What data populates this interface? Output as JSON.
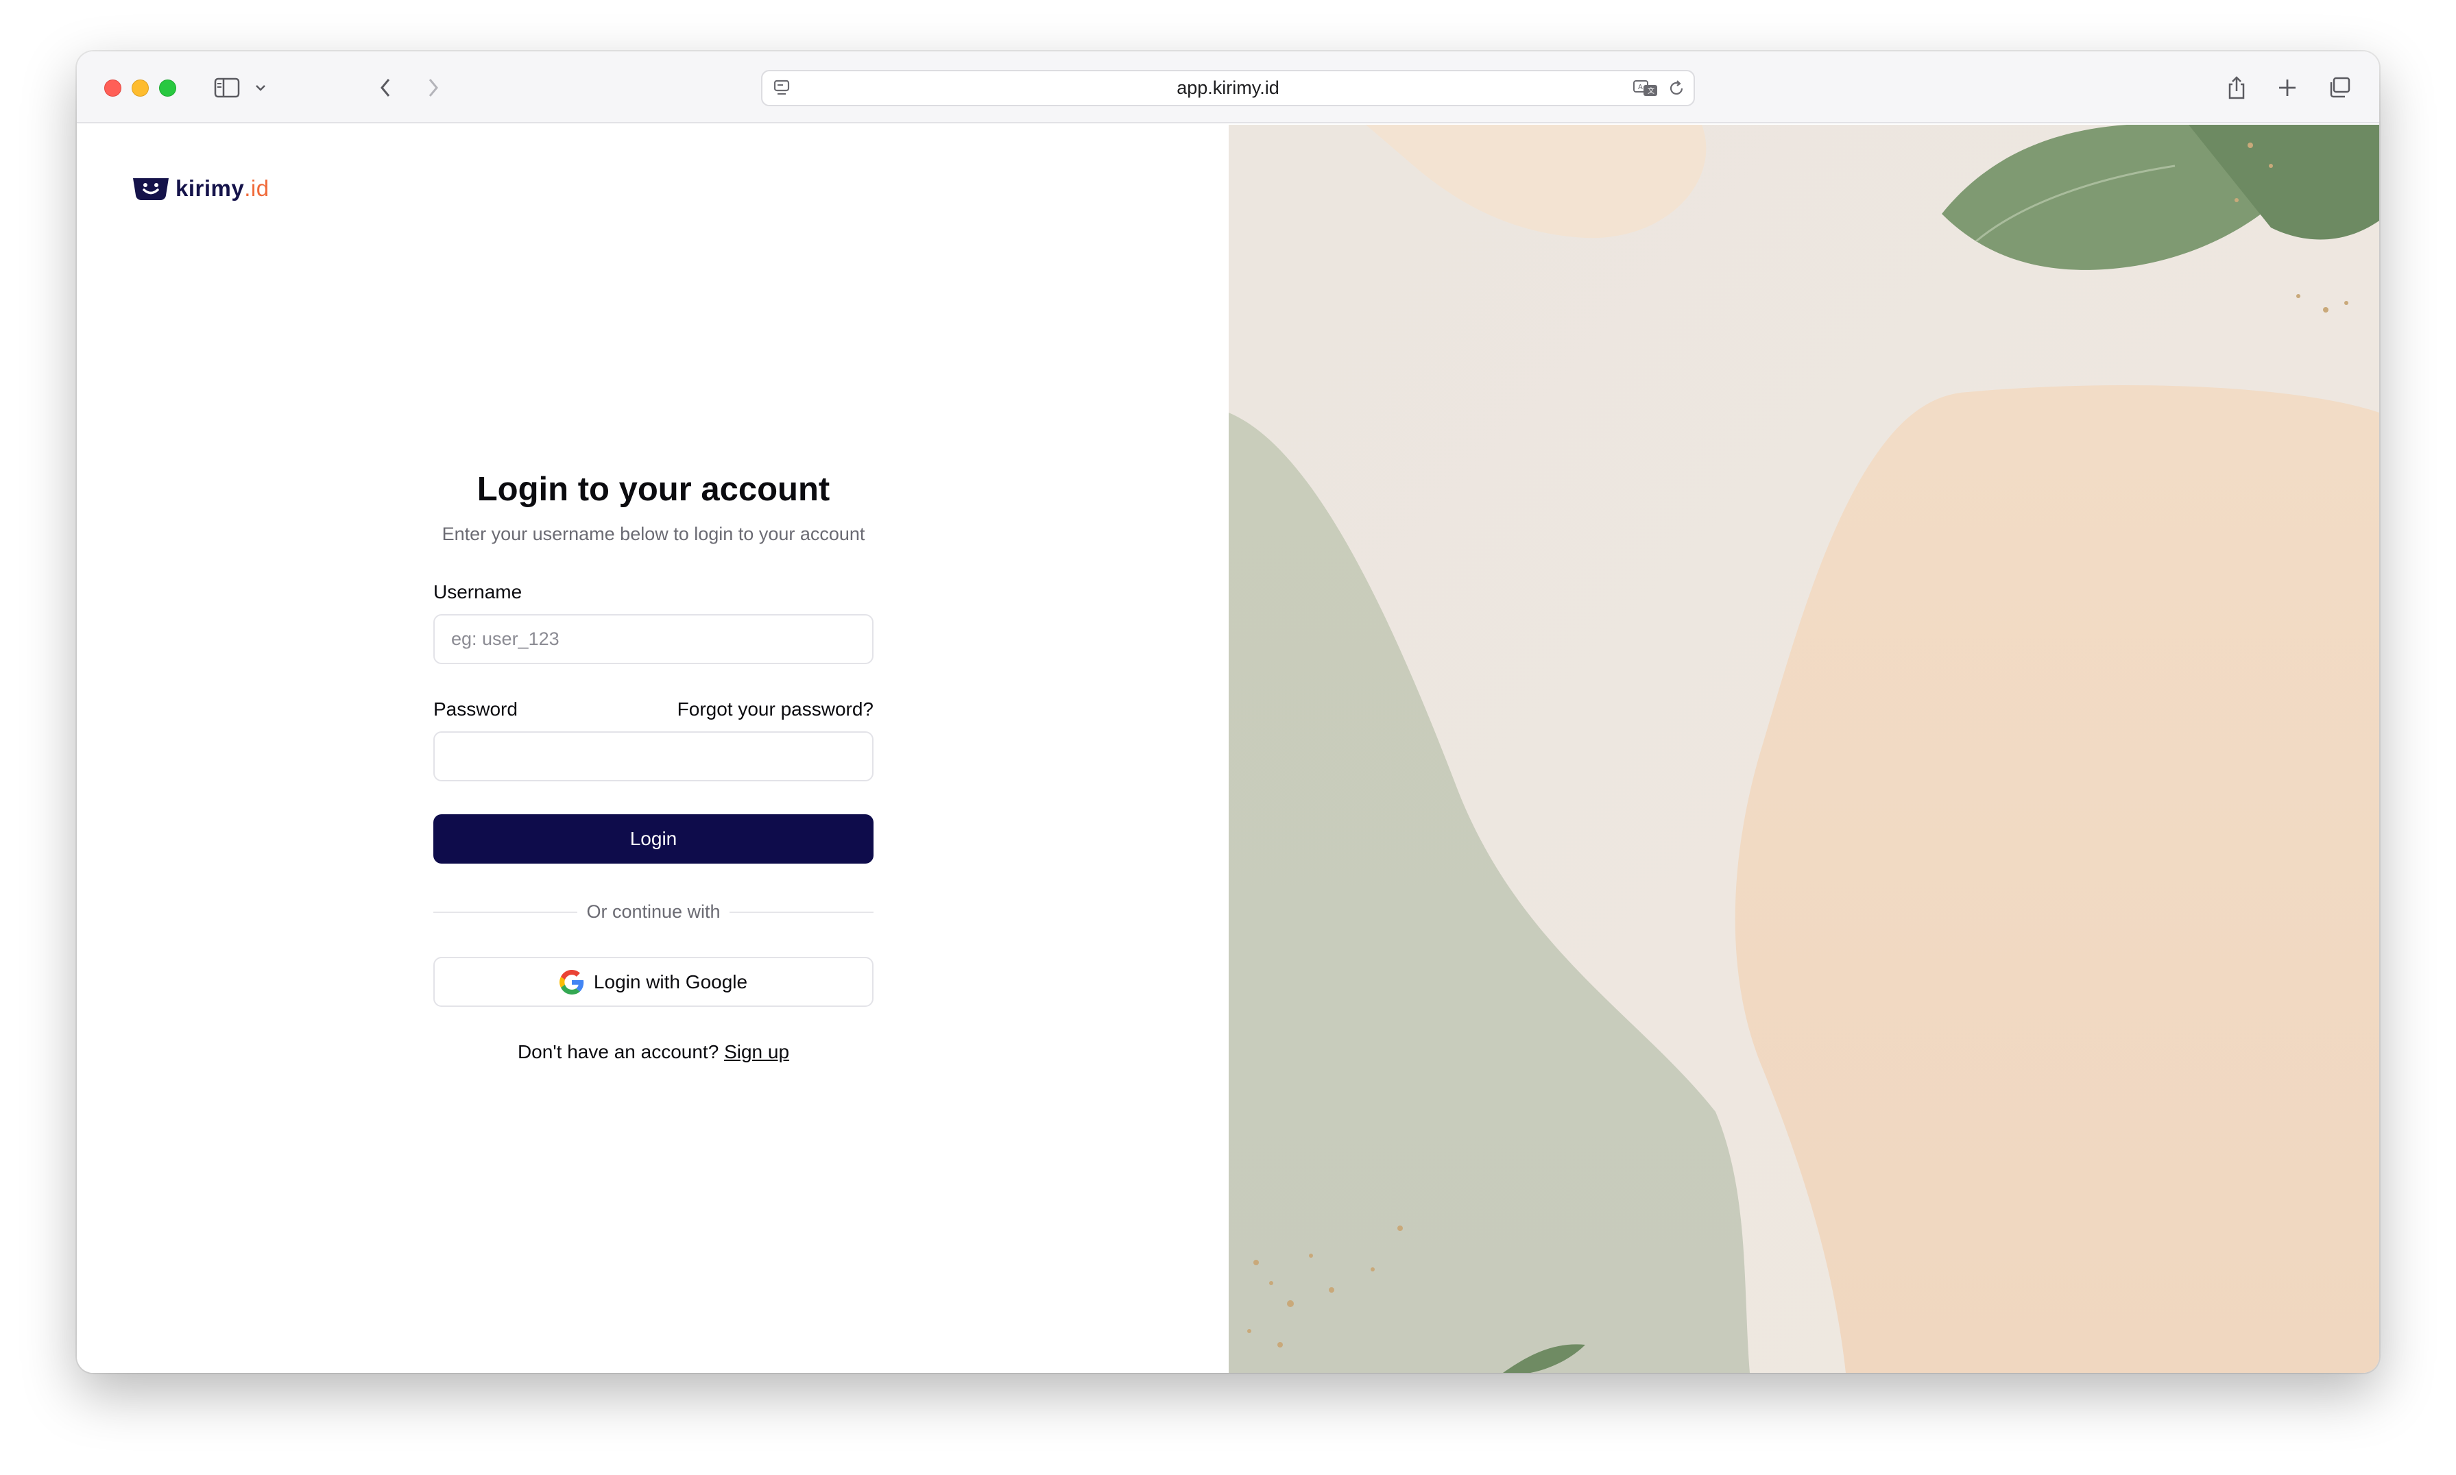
{
  "browser": {
    "url": "app.kirimy.id"
  },
  "logo": {
    "name": "kirimy",
    "suffix": ".id"
  },
  "login": {
    "title": "Login to your account",
    "subtitle": "Enter your username below to login to your account",
    "username_label": "Username",
    "username_placeholder": "eg: user_123",
    "password_label": "Password",
    "forgot_link": "Forgot your password?",
    "login_button": "Login",
    "divider_text": "Or continue with",
    "google_button": "Login with Google",
    "signup_prompt": "Don't have an account?",
    "signup_link": "Sign up"
  },
  "colors": {
    "primary": "#0e0c4b",
    "logo_accent": "#f06a3a"
  }
}
